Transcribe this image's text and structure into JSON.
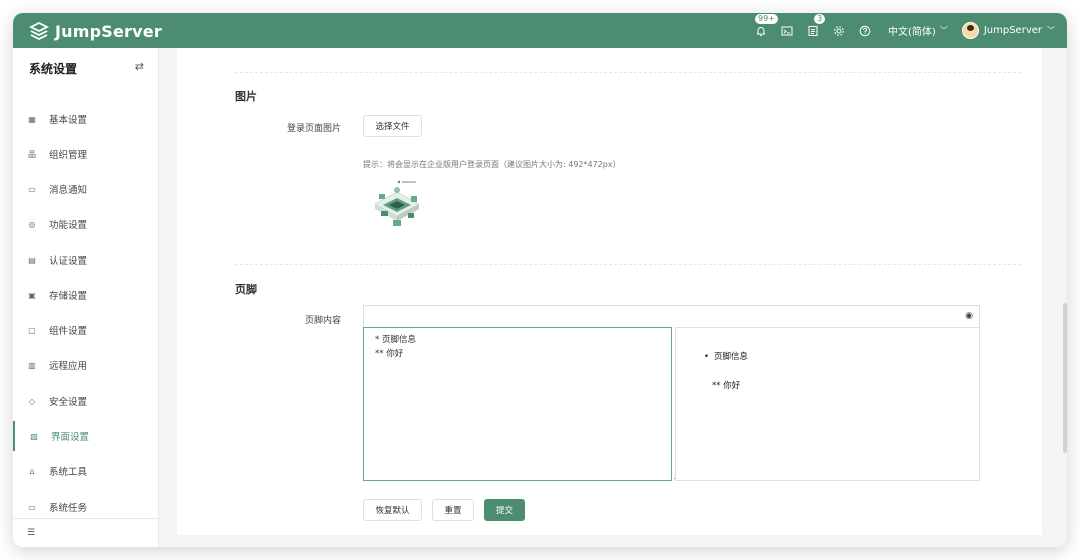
{
  "header": {
    "brand": "JumpServer",
    "notifications_badge": "99+",
    "tickets_badge": "3",
    "language": "中文(简体)",
    "username": "JumpServer",
    "accent_color": "#4c8d72"
  },
  "sidebar": {
    "title": "系统设置",
    "items": [
      {
        "label": "基本设置",
        "icon": "grid-icon"
      },
      {
        "label": "组织管理",
        "icon": "org-icon"
      },
      {
        "label": "消息通知",
        "icon": "message-icon"
      },
      {
        "label": "功能设置",
        "icon": "feature-icon"
      },
      {
        "label": "认证设置",
        "icon": "auth-icon"
      },
      {
        "label": "存储设置",
        "icon": "storage-icon"
      },
      {
        "label": "组件设置",
        "icon": "component-icon"
      },
      {
        "label": "远程应用",
        "icon": "remote-app-icon"
      },
      {
        "label": "安全设置",
        "icon": "shield-icon"
      },
      {
        "label": "界面设置",
        "icon": "interface-icon",
        "active": true
      },
      {
        "label": "系统工具",
        "icon": "toolbox-icon"
      },
      {
        "label": "系统任务",
        "icon": "task-icon"
      }
    ]
  },
  "main": {
    "image_section": {
      "title": "图片",
      "login_image_label": "登录页面图片",
      "choose_file_label": "选择文件",
      "hint": "提示：将会显示在企业版用户登录页面（建议图片大小为: 492*472px）"
    },
    "footer_section": {
      "title": "页脚",
      "content_label": "页脚内容",
      "textarea_value": "* 页脚信息\n** 你好",
      "preview_item": "页脚信息",
      "preview_paragraph": "** 你好"
    },
    "actions": {
      "restore_label": "恢复默认",
      "reset_label": "重置",
      "submit_label": "提交"
    }
  }
}
